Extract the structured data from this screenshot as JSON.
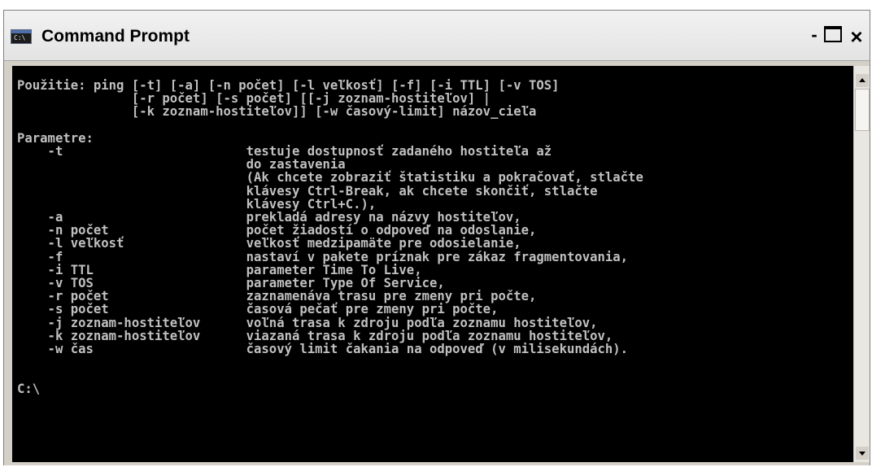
{
  "window": {
    "title": "Command Prompt",
    "icon": "console-window-icon",
    "icon_glyph": "C:\\",
    "controls": {
      "minimize": "-",
      "maximize": "maximize-icon",
      "close": "×"
    }
  },
  "console": {
    "background": "#000000",
    "foreground": "#c0c0c0",
    "lines": [
      "Použitie: ping [-t] [-a] [-n počet] [-l veľkosť] [-f] [-i TTL] [-v TOS]",
      "               [-r počet] [-s počet] [[-j zoznam-hostiteľov] |",
      "               [-k zoznam-hostiteľov]] [-w časový-limit] názov_cieľa",
      "",
      "Parametre:",
      "    -t                        testuje dostupnosť zadaného hostiteľa až",
      "                              do zastavenia",
      "                              (Ak chcete zobraziť štatistiku a pokračovať, stlačte",
      "                              klávesy Ctrl-Break, ak chcete skončiť, stlačte",
      "                              klávesy Ctrl+C.),",
      "    -a                        prekladá adresy na názvy hostiteľov,",
      "    -n počet                  počet žiadostí o odpoveď na odoslanie,",
      "    -l veľkosť                veľkosť medzipamäte pre odosielanie,",
      "    -f                        nastaví v pakete príznak pre zákaz fragmentovania,",
      "    -i TTL                    parameter Time To Live,",
      "    -v TOS                    parameter Type Of Service,",
      "    -r počet                  zaznamenáva trasu pre zmeny pri počte,",
      "    -s počet                  časová pečať pre zmeny pri počte,",
      "    -j zoznam-hostiteľov      voľná trasa k zdroju podľa zoznamu hostiteľov,",
      "    -k zoznam-hostiteľov      viazaná trasa k zdroju podľa zoznamu hostiteľov,",
      "    -w čas                    časový limit čakania na odpoveď (v milisekundách).",
      "",
      "",
      "C:\\"
    ]
  }
}
